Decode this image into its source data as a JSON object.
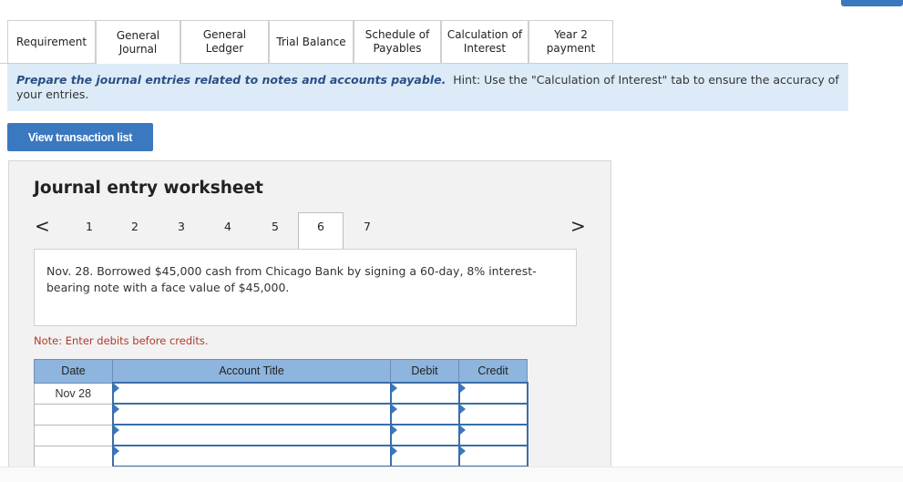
{
  "tabs": [
    {
      "label": "Requirement"
    },
    {
      "label": "General\nJournal"
    },
    {
      "label": "General\nLedger"
    },
    {
      "label": "Trial Balance"
    },
    {
      "label": "Schedule of\nPayables"
    },
    {
      "label": "Calculation of\nInterest"
    },
    {
      "label": "Year 2\npayment"
    }
  ],
  "active_tab": "General Journal",
  "banner": {
    "bold": "Prepare the journal entries related to notes and accounts payable.",
    "hint": "Hint:  Use the \"Calculation of Interest\" tab to ensure the accuracy of your entries."
  },
  "view_button": "View transaction list",
  "worksheet": {
    "title": "Journal entry worksheet",
    "prev": "<",
    "next": ">",
    "pages": [
      "1",
      "2",
      "3",
      "4",
      "5",
      "6",
      "7"
    ],
    "active_page": "6",
    "description": "Nov. 28. Borrowed $45,000 cash from Chicago Bank by signing a 60-day, 8% interest-bearing note with a face value of $45,000.",
    "note": "Note: Enter debits before credits."
  },
  "table": {
    "headers": [
      "Date",
      "Account Title",
      "Debit",
      "Credit"
    ],
    "rows": [
      {
        "date": "Nov 28"
      },
      {
        "date": ""
      },
      {
        "date": ""
      },
      {
        "date": ""
      }
    ]
  },
  "colors": {
    "accent": "#3a78c0",
    "banner_bg": "#dcebf7",
    "table_header": "#8db5de",
    "note_text": "#b03a2e"
  }
}
